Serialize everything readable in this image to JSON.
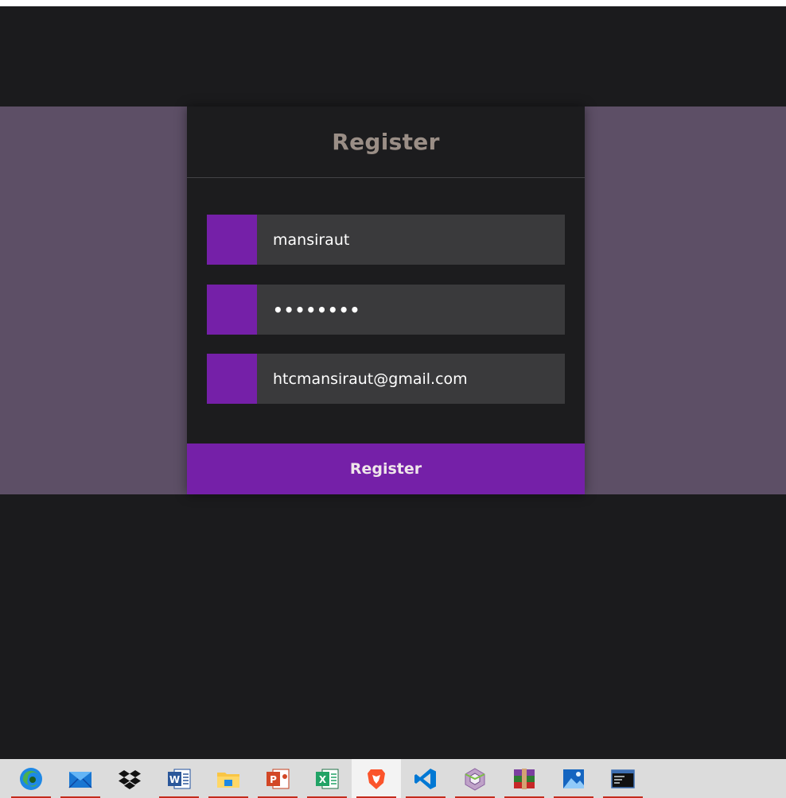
{
  "form": {
    "title": "Register",
    "fields": [
      {
        "name": "username",
        "value": "mansiraut"
      },
      {
        "name": "password",
        "value": "••••••••"
      },
      {
        "name": "email",
        "value": "htcmansiraut@gmail.com"
      }
    ],
    "submit_label": "Register"
  },
  "colors": {
    "accent": "#7520a8",
    "band": "#5d4f66",
    "page_bg": "#1b1b1d",
    "card_bg": "#1c1c1e",
    "input_bg": "#3a3a3c",
    "title": "#9a8e86"
  },
  "taskbar": {
    "items": [
      {
        "icon": "edge-icon"
      },
      {
        "icon": "mail-icon"
      },
      {
        "icon": "dropbox-icon"
      },
      {
        "icon": "word-icon"
      },
      {
        "icon": "file-explorer-icon"
      },
      {
        "icon": "powerpoint-icon"
      },
      {
        "icon": "excel-icon"
      },
      {
        "icon": "brave-icon"
      },
      {
        "icon": "vscode-icon"
      },
      {
        "icon": "netbeans-icon"
      },
      {
        "icon": "winrar-icon"
      },
      {
        "icon": "photos-icon"
      },
      {
        "icon": "mysql-icon"
      }
    ]
  }
}
